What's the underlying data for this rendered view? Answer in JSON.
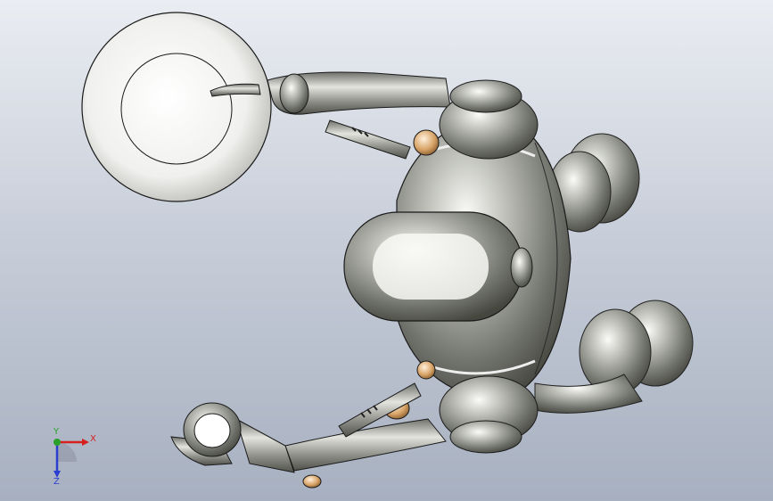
{
  "viewport": {
    "background_top": "#eaedf2",
    "background_bottom": "#a7b0c0"
  },
  "model": {
    "body_color": "#9a9c96",
    "highlight_color": "#f2f2ef",
    "shadow_color": "#55574f",
    "joint_color": "#d9a56a",
    "outline_color": "#1a1a1a"
  },
  "triad": {
    "x_label": "X",
    "y_label": "Y",
    "z_label": "Z",
    "x_color": "#d62020",
    "y_color": "#2aa02a",
    "z_color": "#2a3fd0"
  }
}
